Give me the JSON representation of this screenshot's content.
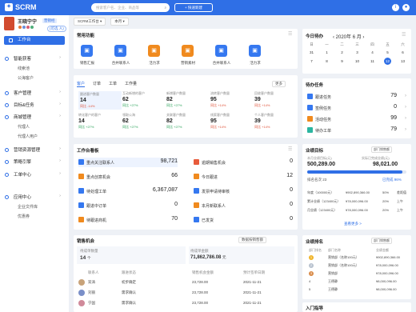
{
  "app": {
    "title": "SCRM",
    "search_placeholder": "搜索客户名、企业、商品等",
    "new_button": "+ 快速新建"
  },
  "user": {
    "name": "王晓宁宁",
    "role": "营销经",
    "status": "(可选 人)"
  },
  "sidebar": {
    "workspace": "工作台",
    "items": [
      {
        "label": "智能获客",
        "subs": [
          "线索池",
          "公海客户"
        ]
      },
      {
        "label": "客户管理",
        "subs": []
      },
      {
        "label": "目标&任务",
        "subs": []
      },
      {
        "label": "商城管理",
        "subs": [
          "代理人",
          "代理人用户"
        ]
      },
      {
        "label": "营销资源管理",
        "subs": []
      },
      {
        "label": "策略引擎",
        "subs": []
      },
      {
        "label": "工单中心",
        "subs": []
      },
      {
        "label": "应用中心",
        "subs": [
          "企业文件库",
          "优惠券"
        ]
      }
    ]
  },
  "breadcrumb": {
    "sel1": "SCRM工作台",
    "sel2": "本月"
  },
  "quick": {
    "title": "常用功能",
    "items": [
      {
        "label": "销售汇报",
        "color": "#3578f0",
        "icon": "report-icon"
      },
      {
        "label": "合并联系人",
        "color": "#3578f0",
        "icon": "merge-icon"
      },
      {
        "label": "活力求",
        "color": "#f08a1e",
        "icon": "activity-icon"
      },
      {
        "label": "营销素材",
        "color": "#f08a1e",
        "icon": "material-icon"
      },
      {
        "label": "合并联系人",
        "color": "#3578f0",
        "icon": "merge-icon"
      },
      {
        "label": "活力求",
        "color": "#3578f0",
        "icon": "activity-icon"
      }
    ]
  },
  "metrics": {
    "tabs": [
      "客户",
      "订单",
      "工单",
      "工作量"
    ],
    "link": "更多",
    "cells": [
      {
        "label": "跟进客户数量",
        "value": "14",
        "delta": "同比 -14%",
        "trend": "down"
      },
      {
        "label": "互动新增的客户",
        "value": "62",
        "delta": "同比 +27%",
        "trend": "up"
      },
      {
        "label": "新增客户数量",
        "value": "82",
        "delta": "同比 +27%",
        "trend": "up"
      },
      {
        "label": "流转客户数量",
        "value": "95",
        "delta": "同比 +14%",
        "trend": "down"
      },
      {
        "label": "回收客户数量",
        "value": "39",
        "delta": "同比 +14%",
        "trend": "down"
      },
      {
        "label": "转化客户的客户",
        "value": "14",
        "delta": "同比 +27%",
        "trend": "up"
      },
      {
        "label": "领取公海",
        "value": "62",
        "delta": "同比 +27%",
        "trend": "up"
      },
      {
        "label": "关联客户数量",
        "value": "82",
        "delta": "同比 +27%",
        "trend": "up"
      },
      {
        "label": "线索客户数量",
        "value": "95",
        "delta": "同比 +14%",
        "trend": "down"
      },
      {
        "label": "个人客户数量",
        "value": "39",
        "delta": "同比 +14%",
        "trend": "down"
      }
    ]
  },
  "workbench": {
    "title": "工作台看板",
    "left": [
      {
        "label": "重点关注联系人",
        "value": "98,721",
        "color": "#3578f0"
      },
      {
        "label": "重点创意机会",
        "value": "66",
        "color": "#f08a1e"
      },
      {
        "label": "待处理工单",
        "value": "6,367,087",
        "color": "#3578f0"
      },
      {
        "label": "跟进中订单",
        "value": "0",
        "color": "#3578f0"
      },
      {
        "label": "待跟进商机",
        "value": "70",
        "color": "#f08a1e"
      }
    ],
    "right": [
      {
        "label": "逾期销售机会",
        "value": "0",
        "color": "#e85b3b"
      },
      {
        "label": "今日跟进",
        "value": "12",
        "color": "#f08a1e"
      },
      {
        "label": "发票申请待审核",
        "value": "0",
        "color": "#3578f0"
      },
      {
        "label": "本月新联系人",
        "value": "0",
        "color": "#f08a1e"
      },
      {
        "label": "已发货",
        "value": "0",
        "color": "#3578f0"
      }
    ]
  },
  "sales": {
    "title": "销售机会",
    "filter": "数据按销售额",
    "win": {
      "label": "待成单数量",
      "value": "14",
      "unit": "个"
    },
    "amt": {
      "label": "待成单金额",
      "value": "71,862,786.08",
      "unit": "元"
    },
    "cols": [
      "联系人",
      "跟进状态",
      "销售机会金额",
      "预计签单日期"
    ],
    "rows": [
      [
        "双涛",
        "初步确定",
        "23,728.00",
        "2021-11-21"
      ],
      [
        "刘丽",
        "需求确认",
        "23,728.00",
        "2021-11-21"
      ],
      [
        "宁国",
        "需求确认",
        "23,728.00",
        "2021-11-21"
      ]
    ]
  },
  "calendar": {
    "title": "今日待办",
    "year": "2020年",
    "month": "6 月",
    "weekdays": [
      "日",
      "一",
      "二",
      "三",
      "四",
      "五",
      "六"
    ],
    "rows": [
      [
        "31",
        "1",
        "2",
        "3",
        "4",
        "5",
        "6"
      ],
      [
        "7",
        "8",
        "9",
        "10",
        "11",
        "12",
        "13"
      ]
    ],
    "today": "12"
  },
  "tasks": {
    "title": "待办任务",
    "items": [
      {
        "label": "跟进任务",
        "value": "79",
        "color": "#3578f0"
      },
      {
        "label": "签例任务",
        "value": "0",
        "color": "#3578f0"
      },
      {
        "label": "活动任务",
        "value": "99",
        "color": "#f08a1e"
      },
      {
        "label": "待办工单",
        "value": "79",
        "color": "#2bb5a0"
      }
    ]
  },
  "goal": {
    "title": "业绩目标",
    "filter": "部门销售额",
    "target_label": "本月业绩目标(元)",
    "target": "500,289.00",
    "actual_label": "实际已完成业绩(元)",
    "actual": "98,021.00",
    "progress_label": "已完成 96%",
    "progress": 0.96,
    "rank_label": "排名名次 23",
    "rows": [
      [
        "年度（100000元）",
        "¥902,890,366.00",
        "50%",
        "差距值"
      ],
      [
        "累计业绩（123400元）",
        "¥78,000,096.00",
        "20%",
        "上午"
      ],
      [
        "月业绩（123400元）",
        "¥78,000,096.00",
        "20%",
        "上午"
      ]
    ],
    "more": "查看更多 >"
  },
  "ranking": {
    "title": "业绩排名",
    "filter": "部门销售额",
    "cols": [
      "部门排名",
      "部门名称",
      "业绩金额"
    ],
    "rows": [
      [
        "1",
        "营销部（名称100元）",
        "¥902,890,366.00"
      ],
      [
        "2",
        "营销部（名称100元）",
        "¥78,000,096.00"
      ],
      [
        "3",
        "营销部",
        "¥78,000,096.00"
      ],
      [
        "4",
        "王德静",
        "¥8,000,096.00"
      ],
      [
        "5",
        "王德静",
        "¥8,000,096.00"
      ]
    ]
  },
  "guide": {
    "title": "入门指导"
  }
}
